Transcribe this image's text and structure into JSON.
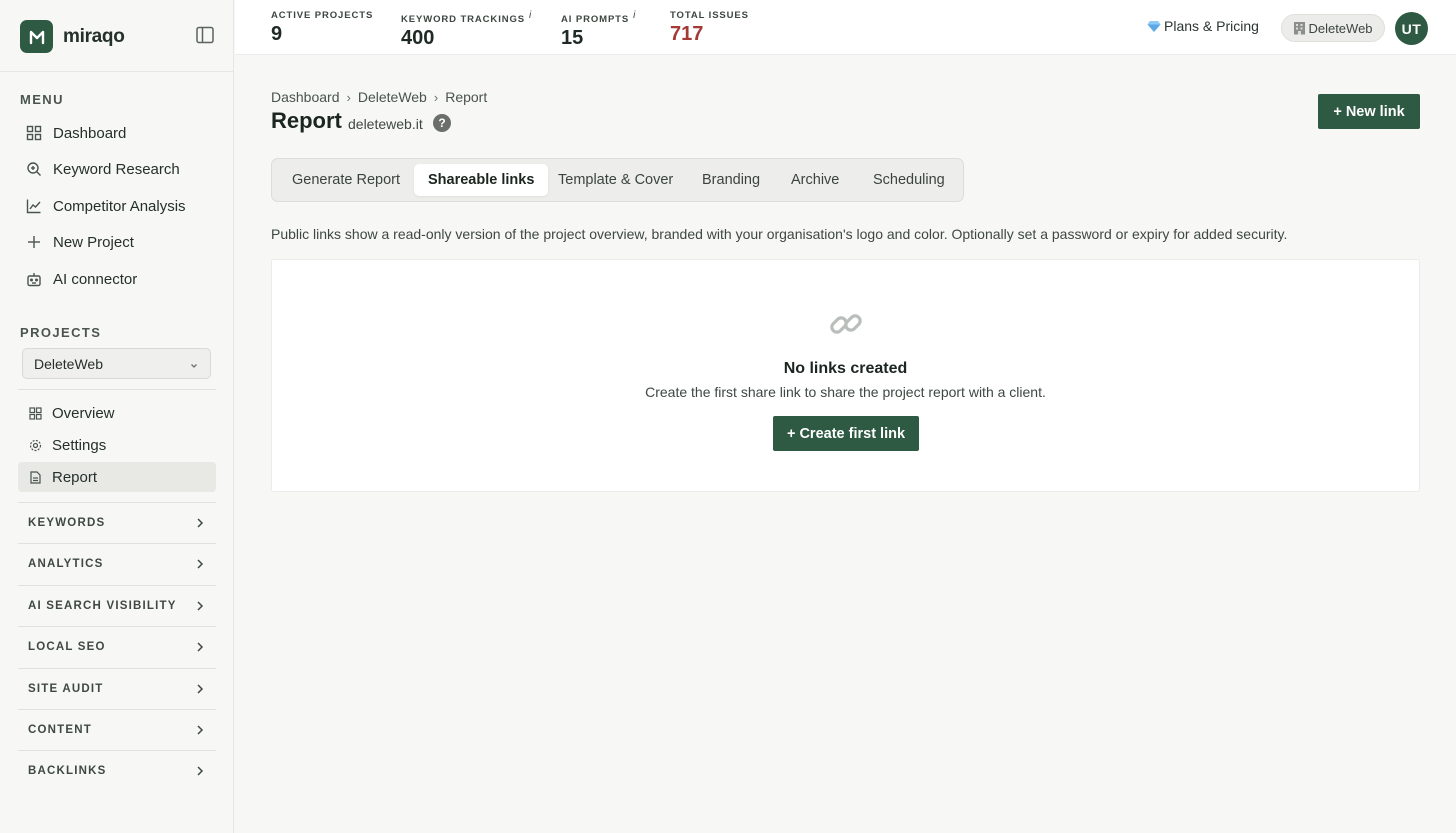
{
  "brand": {
    "name": "miraqo",
    "logo_icon": "leaf-m-icon"
  },
  "colors": {
    "accent": "#2e5a43",
    "danger": "#a33a35"
  },
  "sidebar": {
    "menu_label": "MENU",
    "menu_items": [
      {
        "label": "Dashboard",
        "icon": "grid-icon"
      },
      {
        "label": "Keyword Research",
        "icon": "search-icon"
      },
      {
        "label": "Competitor Analysis",
        "icon": "line-chart-icon"
      },
      {
        "label": "New Project",
        "icon": "plus-icon"
      },
      {
        "label": "AI connector",
        "icon": "robot-icon"
      }
    ],
    "projects_label": "PROJECTS",
    "project_select": {
      "value": "DeleteWeb"
    },
    "project_items": [
      {
        "label": "Overview",
        "icon": "grid-icon"
      },
      {
        "label": "Settings",
        "icon": "gear-icon"
      },
      {
        "label": "Report",
        "icon": "file-icon",
        "active": true
      }
    ],
    "groups": [
      "KEYWORDS",
      "ANALYTICS",
      "AI SEARCH VISIBILITY",
      "LOCAL SEO",
      "SITE AUDIT",
      "CONTENT",
      "BACKLINKS"
    ]
  },
  "topbar": {
    "stats": [
      {
        "label": "ACTIVE PROJECTS",
        "value": "9",
        "info": ""
      },
      {
        "label": "KEYWORD TRACKINGS",
        "value": "400",
        "info": "i"
      },
      {
        "label": "AI PROMPTS",
        "value": "15",
        "info": "i"
      },
      {
        "label": "TOTAL ISSUES",
        "value": "717",
        "info": ""
      }
    ],
    "plans_label": "Plans & Pricing",
    "workspace_label": "DeleteWeb",
    "avatar_initials": "UT"
  },
  "page": {
    "breadcrumb": [
      "Dashboard",
      "DeleteWeb",
      "Report"
    ],
    "title": "Report",
    "domain": "deleteweb.it",
    "help": "?",
    "new_link_label": "+ New link",
    "tabs": [
      "Generate Report",
      "Shareable links",
      "Template & Cover",
      "Branding",
      "Archive",
      "Scheduling"
    ],
    "active_tab": "Shareable links",
    "description": "Public links show a read-only version of the project overview, branded with your organisation's logo and color. Optionally set a password or expiry for added security.",
    "empty_state": {
      "icon": "link-icon",
      "title": "No links created",
      "subtitle": "Create the first share link to share the project report with a client.",
      "button_label": "+ Create first link"
    }
  }
}
